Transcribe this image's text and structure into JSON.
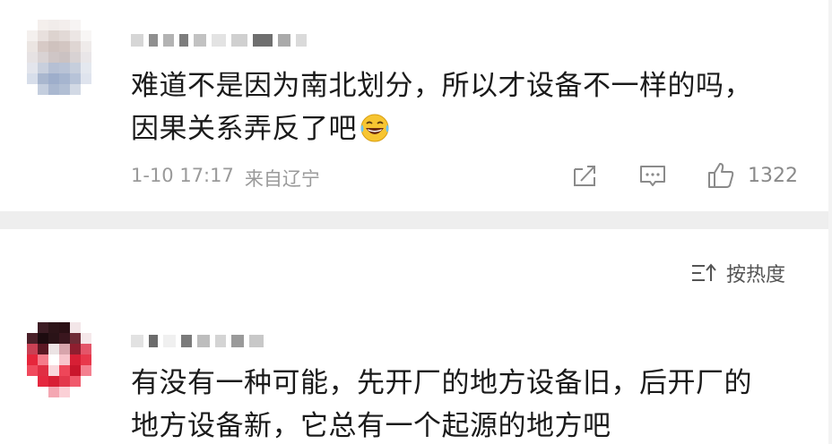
{
  "comments": [
    {
      "text_line1": "难道不是因为南北划分，所以才设备不一样的吗，",
      "text_line2": "因果关系弄反了吧",
      "emoji": "laughing-tears-emoji",
      "time": "1-10 17:17",
      "location": "来自辽宁",
      "like_count": "1322"
    },
    {
      "text_line1": "有没有一种可能，先开厂的地方设备旧，后开厂的",
      "text_line2": "地方设备新，它总有一个起源的地方吧"
    }
  ],
  "sort": {
    "label": "按热度",
    "icon": "sort-icon"
  },
  "icons": {
    "share": "share-icon",
    "comment": "comment-icon",
    "like": "like-icon"
  },
  "colors": {
    "text": "#1a1a1a",
    "meta": "#9a9a9a",
    "divider": "#eeeeee",
    "emoji": "#f7c531"
  }
}
